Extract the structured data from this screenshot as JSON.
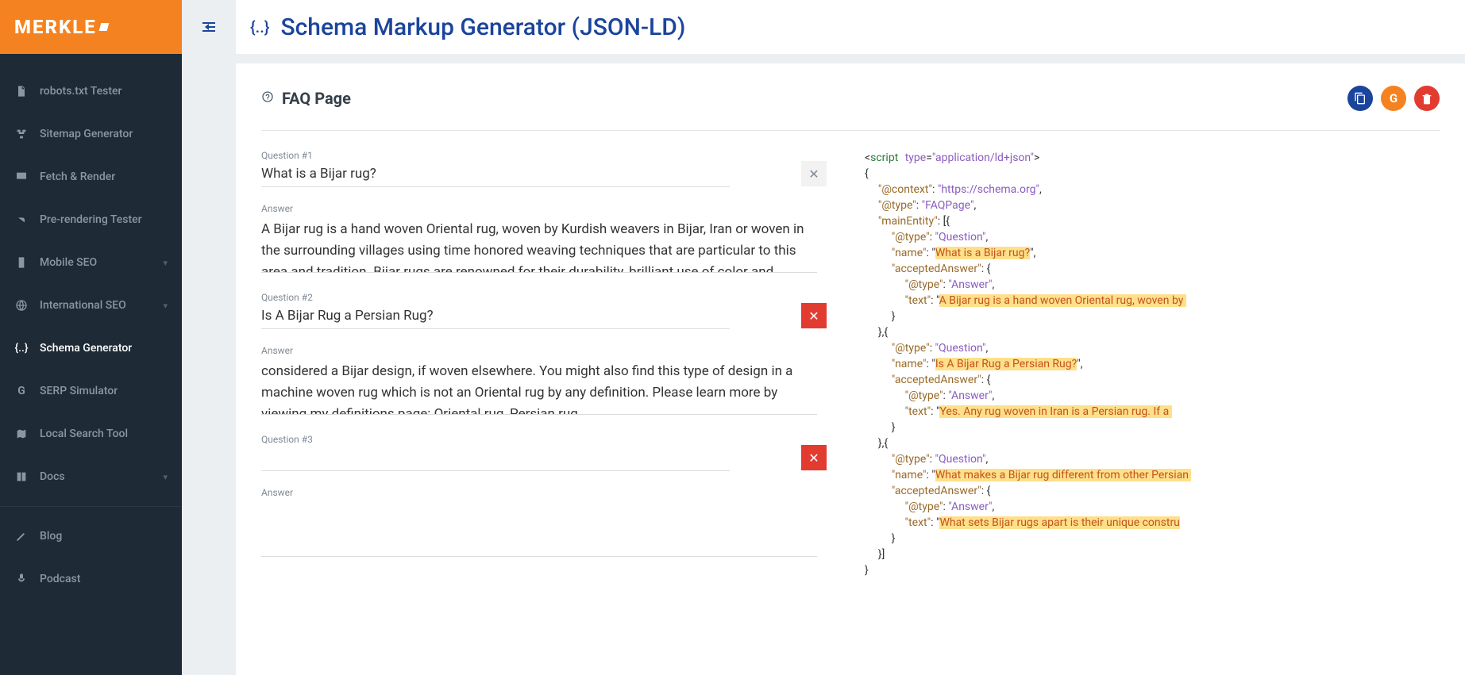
{
  "brand": "MERKLE",
  "header": {
    "title": "Schema Markup Generator (JSON-LD)"
  },
  "sidebar": {
    "items": [
      {
        "label": "robots.txt Tester",
        "icon": "file-icon",
        "chevron": false,
        "active": false
      },
      {
        "label": "Sitemap Generator",
        "icon": "sitemap-icon",
        "chevron": false,
        "active": false
      },
      {
        "label": "Fetch & Render",
        "icon": "monitor-icon",
        "chevron": false,
        "active": false
      },
      {
        "label": "Pre-rendering Tester",
        "icon": "branch-icon",
        "chevron": false,
        "active": false
      },
      {
        "label": "Mobile SEO",
        "icon": "phone-icon",
        "chevron": true,
        "active": false
      },
      {
        "label": "International SEO",
        "icon": "globe-icon",
        "chevron": true,
        "active": false
      },
      {
        "label": "Schema Generator",
        "icon": "braces-icon",
        "chevron": false,
        "active": true
      },
      {
        "label": "SERP Simulator",
        "icon": "google-icon",
        "chevron": false,
        "active": false
      },
      {
        "label": "Local Search Tool",
        "icon": "map-icon",
        "chevron": false,
        "active": false
      },
      {
        "label": "Docs",
        "icon": "book-icon",
        "chevron": true,
        "active": false
      },
      {
        "label": "Blog",
        "icon": "pen-icon",
        "chevron": false,
        "active": false
      },
      {
        "label": "Podcast",
        "icon": "mic-icon",
        "chevron": false,
        "active": false
      }
    ]
  },
  "card": {
    "title": "FAQ Page"
  },
  "questions": [
    {
      "number": "Question #1",
      "question": "What is a Bijar rug?",
      "answer_label": "Answer",
      "answer": "A Bijar rug is a hand woven Oriental rug, woven by Kurdish weavers in Bijar, Iran or woven in the surrounding villages using time honored weaving techniques that are particular to this area and tradition. Bijar rugs are renowned for their durability, brilliant use of color and abundance of designs.",
      "remove_style": "grey"
    },
    {
      "number": "Question #2",
      "question": "Is A Bijar Rug a Persian Rug?",
      "answer_label": "Answer",
      "answer": "considered a Bijar design, if woven elsewhere. You might also find this type of design in a machine woven rug which is not an Oriental rug by any definition. Please learn more by viewing my definitions page: Oriental rug, Persian rug.",
      "remove_style": "red"
    },
    {
      "number": "Question #3",
      "question": "",
      "answer_label": "Answer",
      "answer": "",
      "remove_style": "red"
    }
  ],
  "json_ld": {
    "script_open": "<script type=\"application/ld+json\">",
    "lines": [
      {
        "indent": 0,
        "raw": "{"
      },
      {
        "indent": 1,
        "key": "@context",
        "val": "https://schema.org",
        "comma": true
      },
      {
        "indent": 1,
        "key": "@type",
        "val": "FAQPage",
        "comma": true
      },
      {
        "indent": 1,
        "key": "mainEntity",
        "raw_after": ": [{"
      },
      {
        "indent": 2,
        "key": "@type",
        "val": "Question",
        "comma": true
      },
      {
        "indent": 2,
        "key": "name",
        "hl": "What is a Bijar rug?",
        "comma": true
      },
      {
        "indent": 2,
        "key": "acceptedAnswer",
        "raw_after": ": {"
      },
      {
        "indent": 3,
        "key": "@type",
        "val": "Answer",
        "comma": true
      },
      {
        "indent": 3,
        "key": "text",
        "hl": "A Bijar rug is a hand woven Oriental rug, woven by ",
        "trail": true
      },
      {
        "indent": 2,
        "raw": "}"
      },
      {
        "indent": 1,
        "raw": "},{"
      },
      {
        "indent": 2,
        "key": "@type",
        "val": "Question",
        "comma": true
      },
      {
        "indent": 2,
        "key": "name",
        "hl": "Is A Bijar Rug a Persian Rug?",
        "comma": true
      },
      {
        "indent": 2,
        "key": "acceptedAnswer",
        "raw_after": ": {"
      },
      {
        "indent": 3,
        "key": "@type",
        "val": "Answer",
        "comma": true
      },
      {
        "indent": 3,
        "key": "text",
        "hl": "Yes. Any rug woven in Iran is a Persian rug. If a ",
        "trail": true
      },
      {
        "indent": 2,
        "raw": "}"
      },
      {
        "indent": 1,
        "raw": "},{"
      },
      {
        "indent": 2,
        "key": "@type",
        "val": "Question",
        "comma": true
      },
      {
        "indent": 2,
        "key": "name",
        "hl": "What makes a Bijar rug different from other Persian ",
        "trail": true
      },
      {
        "indent": 2,
        "key": "acceptedAnswer",
        "raw_after": ": {"
      },
      {
        "indent": 3,
        "key": "@type",
        "val": "Answer",
        "comma": true
      },
      {
        "indent": 3,
        "key": "text",
        "hl": "What sets Bijar rugs apart is their unique constru",
        "trail": true
      },
      {
        "indent": 2,
        "raw": "}"
      },
      {
        "indent": 1,
        "raw": "}]"
      },
      {
        "indent": 0,
        "raw": "}"
      }
    ]
  }
}
